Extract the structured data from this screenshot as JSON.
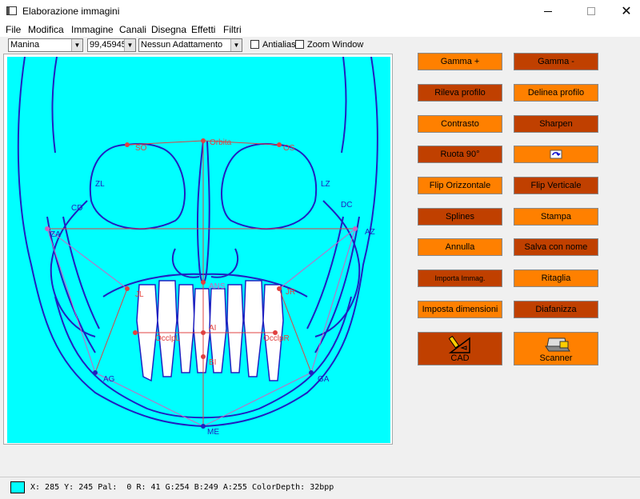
{
  "window": {
    "title": "Elaborazione immagini"
  },
  "menu": [
    "File",
    "Modifica",
    "Immagine",
    "Canali",
    "Disegna",
    "Effetti",
    "Filtri"
  ],
  "toolbar": {
    "tool_select": "Manina",
    "zoom_value": "99,45945",
    "fit_select": "Nessun Adattamento",
    "antialias_label": "Antialias",
    "zoom_window_label": "Zoom Window"
  },
  "buttons": {
    "gamma_plus": "Gamma +",
    "gamma_minus": "Gamma -",
    "rileva_profilo": "Rileva profilo",
    "delinea_profilo": "Delinea profilo",
    "contrasto": "Contrasto",
    "sharpen": "Sharpen",
    "ruota": "Ruota 90°",
    "ruota_icon": "rotate-icon",
    "flip_orizzontale": "Flip Orizzontale",
    "flip_verticale": "Flip Verticale",
    "splines": "Splines",
    "stampa": "Stampa",
    "annulla": "Annulla",
    "salva": "Salva con nome",
    "importa": "Importa Immag.",
    "ritaglia": "Ritaglia",
    "imposta": "Imposta dimensioni",
    "diafanizza": "Diafanizza",
    "cad": "CAD",
    "scanner": "Scanner"
  },
  "canvas_labels": {
    "so": "SO",
    "os": "OS",
    "orbita": "Orbita",
    "zl": "ZL",
    "lz": "LZ",
    "cd": "CD",
    "dc": "DC",
    "za": "ZA",
    "az": "AZ",
    "ans": "ANS",
    "jl": "JL",
    "jr": "JR",
    "ai": "AI",
    "bi": "BI",
    "occlpl": "OcclpL",
    "occlpr": "OcclpR",
    "ag": "AG",
    "ga": "GA",
    "me": "ME"
  },
  "colors": {
    "canvas_bg": "#00ffff",
    "outline": "#2020c0",
    "landmark": "#e04040",
    "guide": "#d060c0",
    "btn_light": "#ff8000",
    "btn_dark": "#c04000"
  },
  "status": {
    "text": "X: 285 Y: 245 Pal:  0 R: 41 G:254 B:249 A:255 ColorDepth: 32bpp"
  }
}
